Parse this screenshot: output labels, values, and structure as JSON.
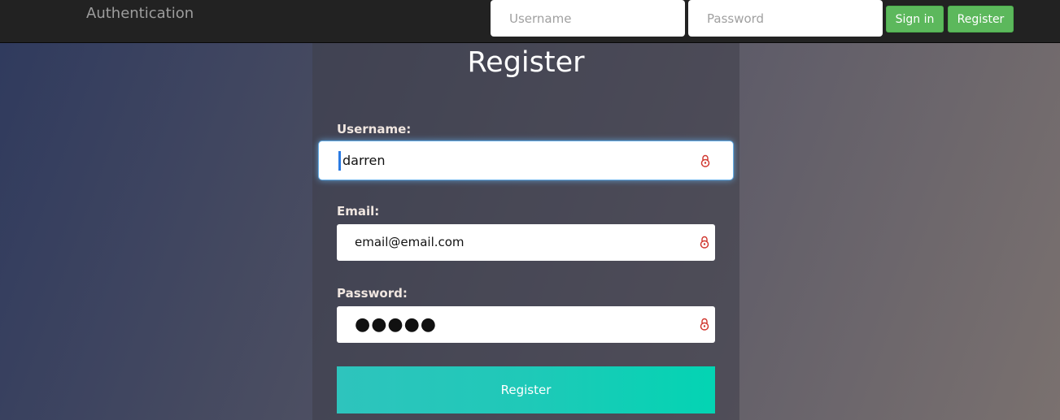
{
  "navbar": {
    "brand": "Authentication",
    "username_placeholder": "Username",
    "password_placeholder": "Password",
    "signin_label": "Sign in",
    "register_label": "Register"
  },
  "form": {
    "title": "Register",
    "username_label": "Username:",
    "username_value": "darren",
    "email_label": "Email:",
    "email_value": "email@email.com",
    "password_label": "Password:",
    "password_masked": "●●●●●",
    "submit_label": "Register"
  },
  "colors": {
    "navbar_bg": "#222222",
    "success_green": "#5cb85c",
    "submit_teal": "#1fc9b8",
    "lock_icon_red": "#d0342c",
    "focus_blue": "#66afe9"
  },
  "icons": {
    "field_adornment": "lock-icon"
  }
}
